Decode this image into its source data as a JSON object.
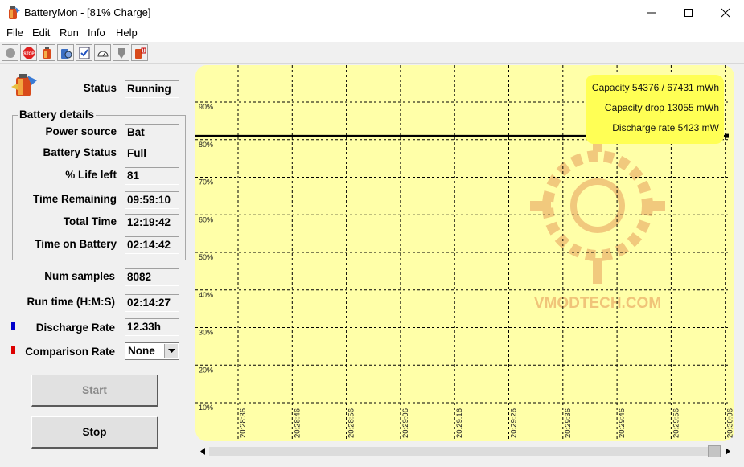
{
  "window": {
    "title": "BatteryMon - [81% Charge]"
  },
  "menu": [
    "File",
    "Edit",
    "Run",
    "Info",
    "Help"
  ],
  "toolbar": {
    "buttons": [
      "record-icon",
      "stop-icon",
      "battery-icon",
      "settings-icon",
      "checklist-icon",
      "gauge-icon",
      "pointer-icon",
      "battery-warning-icon"
    ]
  },
  "status": {
    "label": "Status",
    "value": "Running"
  },
  "details": {
    "title": "Battery details",
    "power_source": {
      "label": "Power source",
      "value": "Bat"
    },
    "battery_status": {
      "label": "Battery Status",
      "value": "Full"
    },
    "life_left": {
      "label": "% Life left",
      "value": "81"
    },
    "time_remaining": {
      "label": "Time Remaining",
      "value": "09:59:10"
    },
    "total_time": {
      "label": "Total Time",
      "value": "12:19:42"
    },
    "time_on_battery": {
      "label": "Time on Battery",
      "value": "02:14:42"
    }
  },
  "num_samples": {
    "label": "Num samples",
    "value": "8082"
  },
  "run_time": {
    "label": "Run time (H:M:S)",
    "value": "02:14:27"
  },
  "discharge_rate": {
    "label": "Discharge Rate",
    "value": "12.33h",
    "color": "#0000cc"
  },
  "comparison": {
    "label": "Comparison Rate",
    "value": "None",
    "color": "#dd0000"
  },
  "buttons": {
    "start": "Start",
    "stop": "Stop"
  },
  "chart_info": {
    "capacity": "Capacity 54376 / 67431 mWh",
    "capacity_drop": "Capacity drop 13055 mWh",
    "discharge_rate": "Discharge rate 5423 mW"
  },
  "watermark": "VMODTECH.COM",
  "colors": {
    "chart_bg": "#ffffa8",
    "info_box": "#ffff55",
    "series": "#000000"
  },
  "chart_data": {
    "type": "line",
    "y_ticks": [
      "90%",
      "80%",
      "70%",
      "60%",
      "50%",
      "40%",
      "30%",
      "20%",
      "10%"
    ],
    "x_ticks": [
      "20:28:36",
      "20:28:46",
      "20:28:56",
      "20:29:06",
      "20:29:16",
      "20:29:26",
      "20:29:36",
      "20:29:46",
      "20:29:56",
      "20:30:06"
    ],
    "ylim": [
      0,
      100
    ],
    "grid": true,
    "series": [
      {
        "values": [
          81,
          81,
          81,
          81,
          81,
          81,
          81,
          81,
          81,
          81
        ]
      }
    ]
  }
}
